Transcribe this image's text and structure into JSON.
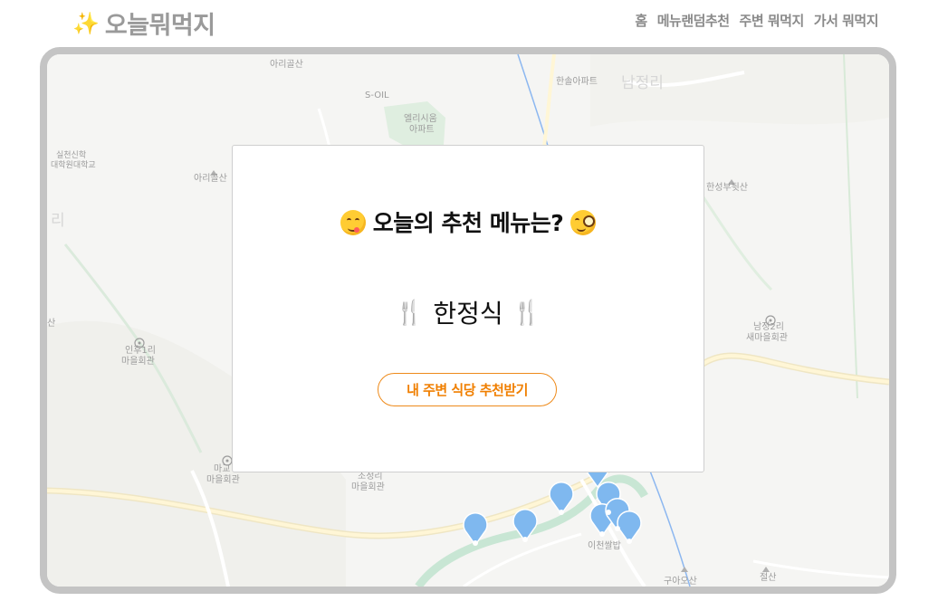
{
  "header": {
    "logo_icon": "sparkles-icon",
    "logo_text": "오늘뭐먹지",
    "nav": [
      {
        "label": "홈"
      },
      {
        "label": "메뉴랜덤추천"
      },
      {
        "label": "주변 뭐먹지"
      },
      {
        "label": "가서 뭐먹지"
      }
    ]
  },
  "map": {
    "labels": {
      "arigolsan_top": "아리골산",
      "soil": "S-OIL",
      "hansol": "한솔아파트",
      "namjeongri": "남정리",
      "ellisium_1": "엘리시움",
      "ellisium_2": "아파트",
      "silcheon_1": "실천신학",
      "silcheon_2": "대학원대학교",
      "arigolsan_left": "아리골산",
      "hanseong": "한성부뒷산",
      "ri": "리",
      "san_left": "산",
      "inhu_1": "인후1리",
      "inhu_2": "마을회관",
      "namjeong2_1": "남정2리",
      "namjeong2_2": "새마을회관",
      "magyo_1": "마교",
      "magyo_2": "마을회관",
      "jojeong_1": "조정리",
      "jojeong_2": "마을회관",
      "icheon": "이천쌀밥",
      "guaosan": "구아오산",
      "jeolsan": "절산"
    },
    "colors": {
      "background": "#f5f5f3",
      "road": "#fff3c2",
      "river": "#c8e6d4",
      "pin": "#7fb8ef"
    }
  },
  "modal": {
    "title": "오늘의 추천 메뉴는?",
    "left_emoji": "yum-face-icon",
    "right_emoji": "monocle-face-icon",
    "utensil_icon": "fork-knife-icon",
    "menu_name": "한정식",
    "button_label": "내 주변 식당 추천받기"
  }
}
